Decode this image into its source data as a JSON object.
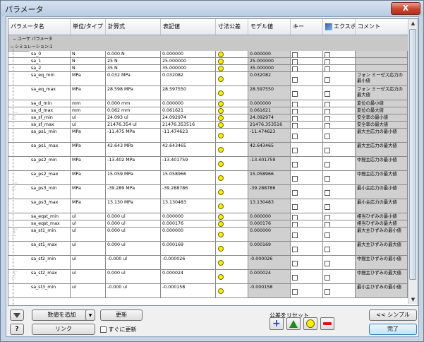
{
  "window": {
    "title": "パラメータ",
    "close_label": "X"
  },
  "columns": [
    "パラメータ名",
    "単位/タイプ",
    "計算式",
    "表記値",
    "寸法公差",
    "モデル値",
    "キー",
    "エクスポ",
    "コメント"
  ],
  "groups": {
    "user": "ユーザ パラメータ",
    "sim": "シミュレーション:1"
  },
  "rows": [
    {
      "name": "sa_0",
      "unit": "N",
      "formula": "0.000 N",
      "nominal": "0.000000",
      "model": "0.000000",
      "comment": ""
    },
    {
      "name": "sa_1",
      "unit": "N",
      "formula": "25 N",
      "nominal": "25.000000",
      "model": "25.000000",
      "comment": ""
    },
    {
      "name": "sa_2",
      "unit": "N",
      "formula": "35 N",
      "nominal": "35.000000",
      "model": "35.000000",
      "comment": ""
    },
    {
      "name": "sa_eq_min",
      "unit": "MPa",
      "formula": "0.032 MPa",
      "nominal": "0.032082",
      "model": "0.032082",
      "comment": "フォン ミーゼス応力の最小値"
    },
    {
      "name": "sa_eq_max",
      "unit": "MPa",
      "formula": "28.598 MPa",
      "nominal": "28.597550",
      "model": "28.597550",
      "comment": "フォン ミーゼス応力の最大値"
    },
    {
      "name": "sa_d_min",
      "unit": "mm",
      "formula": "0.000 mm",
      "nominal": "0.000000",
      "model": "0.000000",
      "comment": "変位の最小値"
    },
    {
      "name": "sa_d_max",
      "unit": "mm",
      "formula": "0.062 mm",
      "nominal": "0.061621",
      "model": "0.061621",
      "comment": "変位の最大値"
    },
    {
      "name": "sa_sf_min",
      "unit": "ul",
      "formula": "24.093 ul",
      "nominal": "24.092974",
      "model": "24.092974",
      "comment": "安全率の最小値"
    },
    {
      "name": "sa_sf_max",
      "unit": "ul",
      "formula": "21476.354 ul",
      "nominal": "21476.353516",
      "model": "21476.353516",
      "comment": "安全率の最大値"
    },
    {
      "name": "sa_ps1_min",
      "unit": "MPa",
      "formula": "-11.475 MPa",
      "nominal": "-11.474623",
      "model": "-11.474623",
      "comment": "最大主応力の最小値"
    },
    {
      "name": "sa_ps1_max",
      "unit": "MPa",
      "formula": "42.643 MPa",
      "nominal": "42.643465",
      "model": "42.643465",
      "comment": "最大主応力の最大値"
    },
    {
      "name": "sa_ps2_min",
      "unit": "MPa",
      "formula": "-13.402 MPa",
      "nominal": "-13.401759",
      "model": "-13.401759",
      "comment": "中間主応力の最小値"
    },
    {
      "name": "sa_ps2_max",
      "unit": "MPa",
      "formula": "15.059 MPa",
      "nominal": "15.058966",
      "model": "15.058966",
      "comment": "中間主応力の最大値"
    },
    {
      "name": "sa_ps3_min",
      "unit": "MPa",
      "formula": "-39.289 MPa",
      "nominal": "-39.288786",
      "model": "-39.288786",
      "comment": "最小主応力の最小値"
    },
    {
      "name": "sa_ps3_max",
      "unit": "MPa",
      "formula": "13.130 MPa",
      "nominal": "13.130483",
      "model": "13.130483",
      "comment": "最小主応力の最大値"
    },
    {
      "name": "sa_eqst_min",
      "unit": "ul",
      "formula": "0.000 ul",
      "nominal": "0.000000",
      "model": "0.000000",
      "comment": "相当ひずみの最小値"
    },
    {
      "name": "sa_eqst_max",
      "unit": "ul",
      "formula": "0.000 ul",
      "nominal": "0.000176",
      "model": "0.000176",
      "comment": "相当ひずみの最大値"
    },
    {
      "name": "sa_st1_min",
      "unit": "ul",
      "formula": "0.000 ul",
      "nominal": "0.000000",
      "model": "0.000000",
      "comment": "最大主ひずみの最小値"
    },
    {
      "name": "sa_st1_max",
      "unit": "ul",
      "formula": "0.000 ul",
      "nominal": "0.000169",
      "model": "0.000169",
      "comment": "最大主ひずみの最大値"
    },
    {
      "name": "sa_st2_min",
      "unit": "ul",
      "formula": "-0.000 ul",
      "nominal": "-0.000026",
      "model": "-0.000026",
      "comment": "中間主ひずみの最小値"
    },
    {
      "name": "sa_st2_max",
      "unit": "ul",
      "formula": "0.000 ul",
      "nominal": "0.000024",
      "model": "0.000024",
      "comment": "中間主ひずみの最大値"
    },
    {
      "name": "sa_st3_min",
      "unit": "ul",
      "formula": "-0.000 ul",
      "nominal": "-0.000158",
      "model": "-0.000158",
      "comment": "最小主ひずみの最小値"
    }
  ],
  "buttons": {
    "add_number": "数値を追加",
    "update": "更新",
    "link": "リンク",
    "immediate_update": "すぐに更新",
    "reset_tolerance": "公差をリセット",
    "simple": "<< シンプル",
    "done": "完了"
  },
  "icons": {
    "filter": "filter-icon",
    "help": "help-icon",
    "plus": "plus-icon",
    "triangle": "upper-tolerance-icon",
    "circle": "median-tolerance-icon",
    "minus": "minus-icon"
  },
  "colors": {
    "tolerance_dot": "#ffee00",
    "gray_cell": "#d0d0d0"
  }
}
